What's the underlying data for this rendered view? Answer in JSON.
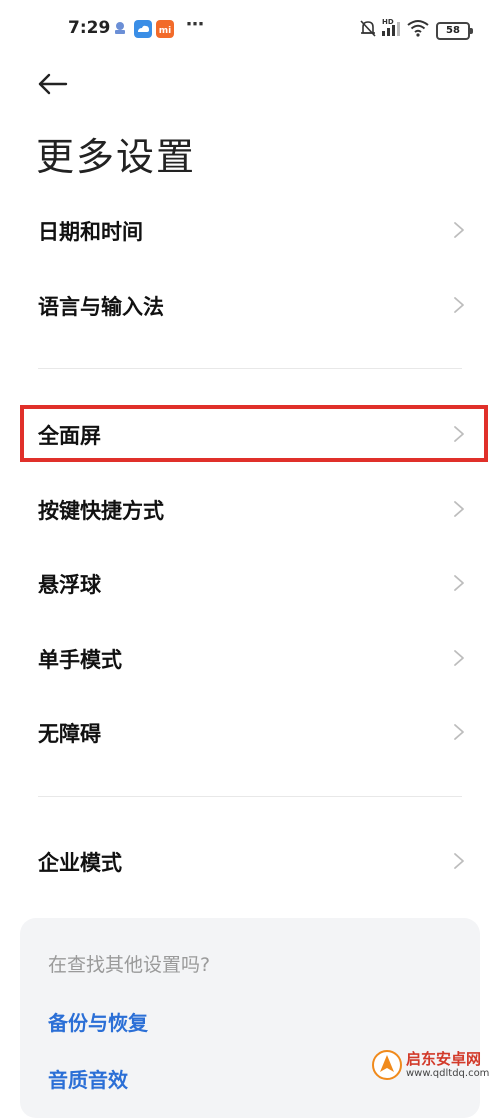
{
  "status_bar": {
    "time": "7:29",
    "dots": "⋯",
    "battery": "58",
    "icons": [
      "notification-icon",
      "cloud-app-icon",
      "mi-app-icon",
      "mute-icon",
      "hd-signal-icon",
      "wifi-icon",
      "battery-icon"
    ]
  },
  "header": {
    "back_icon": "back-arrow-icon",
    "title": "更多设置"
  },
  "sections": [
    {
      "items": [
        {
          "label": "日期和时间"
        },
        {
          "label": "语言与输入法"
        }
      ]
    },
    {
      "items": [
        {
          "label": "全面屏",
          "highlighted": true
        },
        {
          "label": "按键快捷方式"
        },
        {
          "label": "悬浮球"
        },
        {
          "label": "单手模式"
        },
        {
          "label": "无障碍"
        }
      ]
    },
    {
      "items": [
        {
          "label": "企业模式"
        }
      ]
    }
  ],
  "suggestions": {
    "title": "在查找其他设置吗?",
    "links": [
      {
        "label": "备份与恢复"
      },
      {
        "label": "音质音效"
      }
    ]
  },
  "watermark": {
    "name": "启东安卓网",
    "url": "www.qdltdq.com"
  },
  "colors": {
    "highlight": "#e0302a",
    "link": "#2b6fd6",
    "card_bg": "#f3f4f6"
  }
}
